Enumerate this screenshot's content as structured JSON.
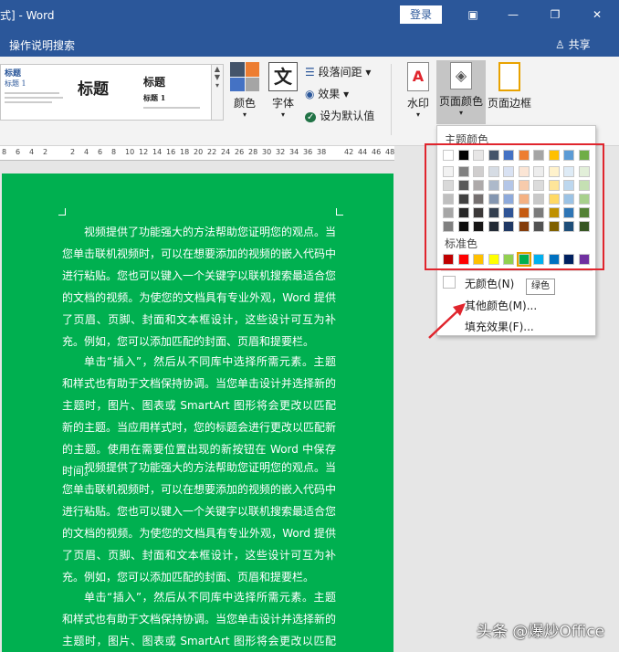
{
  "titlebar": {
    "title": "式] - Word",
    "login": "登录"
  },
  "menubar": {
    "search_hint": "操作说明搜索",
    "share": "共享"
  },
  "gallery": {
    "items": [
      {
        "heading": "标题",
        "sub": "标题 1"
      },
      {
        "heading": "标题",
        "sub": ""
      },
      {
        "heading": "标题",
        "sub": "标题 1"
      }
    ]
  },
  "ribbon": {
    "colors": "颜色",
    "fonts": "字体",
    "paragraph_spacing": "段落间距",
    "effects": "效果",
    "set_default": "设为默认值",
    "watermark": "水印",
    "page_color": "页面颜色",
    "page_borders": "页面边框"
  },
  "ruler": {
    "ticks": [
      "8",
      "6",
      "4",
      "2",
      "",
      "2",
      "4",
      "6",
      "8",
      "10",
      "12",
      "14",
      "16",
      "18",
      "20",
      "22",
      "24",
      "26",
      "28",
      "30",
      "32",
      "34",
      "36",
      "38",
      "",
      "42",
      "44",
      "46",
      "48"
    ]
  },
  "document": {
    "background": "#00b050",
    "paragraphs": [
      "视频提供了功能强大的方法帮助您证明您的观点。当您单击联机视频时，可以在想要添加的视频的嵌入代码中进行粘贴。您也可以键入一个关键字以联机搜索最适合您的文档的视频。为使您的文档具有专业外观，Word 提供了页眉、页脚、封面和文本框设计，这些设计可互为补充。例如，您可以添加匹配的封面、页眉和提要栏。",
      "单击“插入”，然后从不同库中选择所需元素。主题和样式也有助于文档保持协调。当您单击设计并选择新的主题时，图片、图表或 SmartArt 图形将会更改以匹配新的主题。当应用样式时，您的标题会进行更改以匹配新的主题。使用在需要位置出现的新按钮在 Word 中保存时间。",
      "视频提供了功能强大的方法帮助您证明您的观点。当您单击联机视频时，可以在想要添加的视频的嵌入代码中进行粘贴。您也可以键入一个关键字以联机搜索最适合您的文档的视频。为使您的文档具有专业外观，Word 提供了页眉、页脚、封面和文本框设计，这些设计可互为补充。例如，您可以添加匹配的封面、页眉和提要栏。",
      "单击“插入”，然后从不同库中选择所需元素。主题和样式也有助于文档保持协调。当您单击设计并选择新的主题时，图片、图表或 SmartArt 图形将会更改以匹配新的主题。"
    ]
  },
  "dropdown": {
    "theme_colors_label": "主题颜色",
    "standard_colors_label": "标准色",
    "theme_top": [
      "#ffffff",
      "#000000",
      "#e7e6e6",
      "#44546a",
      "#4472c4",
      "#ed7d31",
      "#a5a5a5",
      "#ffc000",
      "#5b9bd5",
      "#70ad47"
    ],
    "theme_shades": [
      [
        "#f2f2f2",
        "#d9d9d9",
        "#bfbfbf",
        "#a6a6a6",
        "#808080"
      ],
      [
        "#808080",
        "#595959",
        "#404040",
        "#262626",
        "#0d0d0d"
      ],
      [
        "#d0cece",
        "#aeaaaa",
        "#757070",
        "#3b3838",
        "#171616"
      ],
      [
        "#d6dce4",
        "#adb9ca",
        "#8496b0",
        "#333f4f",
        "#222a35"
      ],
      [
        "#d9e2f3",
        "#b4c6e7",
        "#8eaadb",
        "#2f5496",
        "#1f3864"
      ],
      [
        "#fbe5d5",
        "#f7cbac",
        "#f4b183",
        "#c55a11",
        "#833c0b"
      ],
      [
        "#ededed",
        "#dbdbdb",
        "#c9c9c9",
        "#7b7b7b",
        "#525252"
      ],
      [
        "#fff2cc",
        "#fee599",
        "#ffd965",
        "#bf9000",
        "#7f6000"
      ],
      [
        "#deebf6",
        "#bdd7ee",
        "#9cc3e5",
        "#2e75b5",
        "#1e4e79"
      ],
      [
        "#e2efd9",
        "#c5e0b3",
        "#a8d08d",
        "#538135",
        "#375623"
      ]
    ],
    "standard": [
      "#c00000",
      "#ff0000",
      "#ffc000",
      "#ffff00",
      "#92d050",
      "#00b050",
      "#00b0f0",
      "#0070c0",
      "#002060",
      "#7030a0"
    ],
    "no_color": "无颜色(N)",
    "more_colors": "其他颜色(M)...",
    "fill_effects": "填充效果(F)...",
    "tooltip": "绿色"
  },
  "watermark": "头条 @爆炒Office"
}
